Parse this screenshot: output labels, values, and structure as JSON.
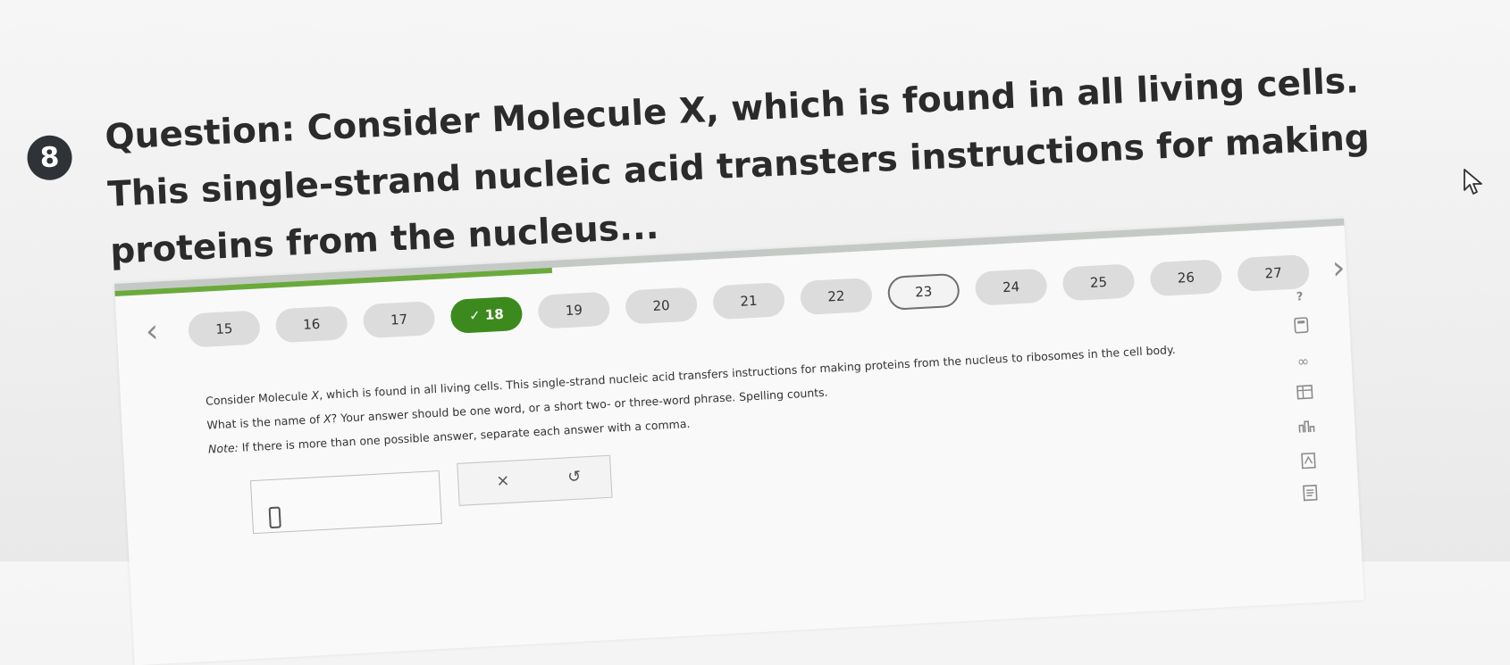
{
  "question": {
    "number": "8",
    "title": "Question: Consider Molecule X, which is found in all living cells. This single-strand nucleic acid transters instructions for making proteins from the nucleus..."
  },
  "nav": {
    "prev_icon": "chevron-left-icon",
    "next_icon": "chevron-right-icon",
    "pills": [
      {
        "label": "15",
        "state": "default"
      },
      {
        "label": "16",
        "state": "default"
      },
      {
        "label": "17",
        "state": "default"
      },
      {
        "label": "18",
        "state": "completed",
        "check": "✓"
      },
      {
        "label": "19",
        "state": "default"
      },
      {
        "label": "20",
        "state": "default"
      },
      {
        "label": "21",
        "state": "default"
      },
      {
        "label": "22",
        "state": "default"
      },
      {
        "label": "23",
        "state": "current"
      },
      {
        "label": "24",
        "state": "default"
      },
      {
        "label": "25",
        "state": "default"
      },
      {
        "label": "26",
        "state": "default"
      },
      {
        "label": "27",
        "state": "default"
      }
    ]
  },
  "content": {
    "prompt_part1": "Consider Molecule ",
    "prompt_var": "X",
    "prompt_part2": ", which is found in all living cells. This single-strand nucleic acid transfers instructions for making proteins from the nucleus to ribosomes in the cell body.",
    "question_part1": "What is the name of ",
    "question_var": "X",
    "question_part2": "? Your answer should be one word, or a short two- or three-word phrase. Spelling counts.",
    "note_label": "Note:",
    "note_text": " If there is more than one possible answer, separate each answer with a comma."
  },
  "answer": {
    "value": ""
  },
  "tools": {
    "clear_label": "×",
    "undo_label": "↺"
  },
  "sidebar": {
    "help": "?",
    "calculator": "calculator-icon",
    "infinity": "∞",
    "data_table": "table-icon",
    "periodic_table": "periodic-table-icon",
    "reference": "reference-icon",
    "notes": "notes-icon"
  },
  "colors": {
    "progress": "#6aaa3c",
    "completed": "#3c8a1e",
    "pill": "#dcdcdc"
  }
}
